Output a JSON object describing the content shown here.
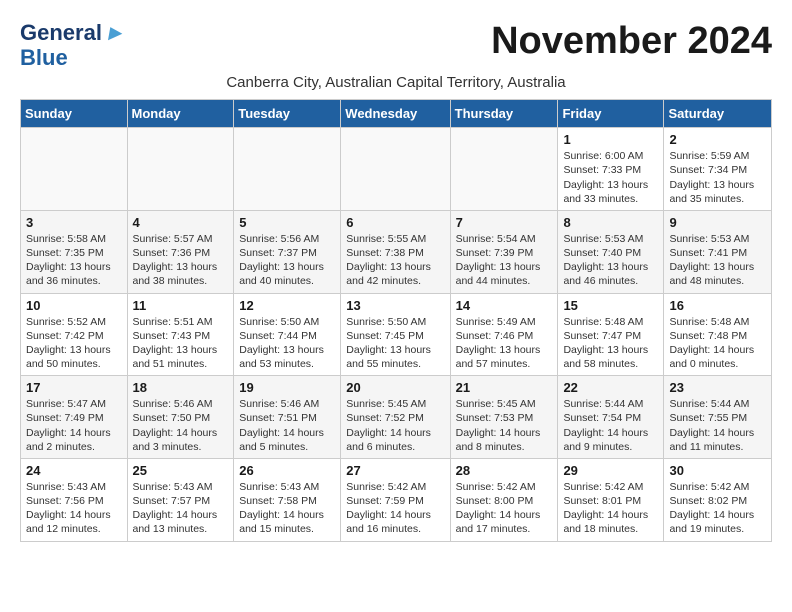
{
  "logo": {
    "line1": "General",
    "line2": "Blue",
    "arrow": "▶"
  },
  "title": "November 2024",
  "subtitle": "Canberra City, Australian Capital Territory, Australia",
  "days_of_week": [
    "Sunday",
    "Monday",
    "Tuesday",
    "Wednesday",
    "Thursday",
    "Friday",
    "Saturday"
  ],
  "weeks": [
    [
      {
        "day": "",
        "info": ""
      },
      {
        "day": "",
        "info": ""
      },
      {
        "day": "",
        "info": ""
      },
      {
        "day": "",
        "info": ""
      },
      {
        "day": "",
        "info": ""
      },
      {
        "day": "1",
        "info": "Sunrise: 6:00 AM\nSunset: 7:33 PM\nDaylight: 13 hours\nand 33 minutes."
      },
      {
        "day": "2",
        "info": "Sunrise: 5:59 AM\nSunset: 7:34 PM\nDaylight: 13 hours\nand 35 minutes."
      }
    ],
    [
      {
        "day": "3",
        "info": "Sunrise: 5:58 AM\nSunset: 7:35 PM\nDaylight: 13 hours\nand 36 minutes."
      },
      {
        "day": "4",
        "info": "Sunrise: 5:57 AM\nSunset: 7:36 PM\nDaylight: 13 hours\nand 38 minutes."
      },
      {
        "day": "5",
        "info": "Sunrise: 5:56 AM\nSunset: 7:37 PM\nDaylight: 13 hours\nand 40 minutes."
      },
      {
        "day": "6",
        "info": "Sunrise: 5:55 AM\nSunset: 7:38 PM\nDaylight: 13 hours\nand 42 minutes."
      },
      {
        "day": "7",
        "info": "Sunrise: 5:54 AM\nSunset: 7:39 PM\nDaylight: 13 hours\nand 44 minutes."
      },
      {
        "day": "8",
        "info": "Sunrise: 5:53 AM\nSunset: 7:40 PM\nDaylight: 13 hours\nand 46 minutes."
      },
      {
        "day": "9",
        "info": "Sunrise: 5:53 AM\nSunset: 7:41 PM\nDaylight: 13 hours\nand 48 minutes."
      }
    ],
    [
      {
        "day": "10",
        "info": "Sunrise: 5:52 AM\nSunset: 7:42 PM\nDaylight: 13 hours\nand 50 minutes."
      },
      {
        "day": "11",
        "info": "Sunrise: 5:51 AM\nSunset: 7:43 PM\nDaylight: 13 hours\nand 51 minutes."
      },
      {
        "day": "12",
        "info": "Sunrise: 5:50 AM\nSunset: 7:44 PM\nDaylight: 13 hours\nand 53 minutes."
      },
      {
        "day": "13",
        "info": "Sunrise: 5:50 AM\nSunset: 7:45 PM\nDaylight: 13 hours\nand 55 minutes."
      },
      {
        "day": "14",
        "info": "Sunrise: 5:49 AM\nSunset: 7:46 PM\nDaylight: 13 hours\nand 57 minutes."
      },
      {
        "day": "15",
        "info": "Sunrise: 5:48 AM\nSunset: 7:47 PM\nDaylight: 13 hours\nand 58 minutes."
      },
      {
        "day": "16",
        "info": "Sunrise: 5:48 AM\nSunset: 7:48 PM\nDaylight: 14 hours\nand 0 minutes."
      }
    ],
    [
      {
        "day": "17",
        "info": "Sunrise: 5:47 AM\nSunset: 7:49 PM\nDaylight: 14 hours\nand 2 minutes."
      },
      {
        "day": "18",
        "info": "Sunrise: 5:46 AM\nSunset: 7:50 PM\nDaylight: 14 hours\nand 3 minutes."
      },
      {
        "day": "19",
        "info": "Sunrise: 5:46 AM\nSunset: 7:51 PM\nDaylight: 14 hours\nand 5 minutes."
      },
      {
        "day": "20",
        "info": "Sunrise: 5:45 AM\nSunset: 7:52 PM\nDaylight: 14 hours\nand 6 minutes."
      },
      {
        "day": "21",
        "info": "Sunrise: 5:45 AM\nSunset: 7:53 PM\nDaylight: 14 hours\nand 8 minutes."
      },
      {
        "day": "22",
        "info": "Sunrise: 5:44 AM\nSunset: 7:54 PM\nDaylight: 14 hours\nand 9 minutes."
      },
      {
        "day": "23",
        "info": "Sunrise: 5:44 AM\nSunset: 7:55 PM\nDaylight: 14 hours\nand 11 minutes."
      }
    ],
    [
      {
        "day": "24",
        "info": "Sunrise: 5:43 AM\nSunset: 7:56 PM\nDaylight: 14 hours\nand 12 minutes."
      },
      {
        "day": "25",
        "info": "Sunrise: 5:43 AM\nSunset: 7:57 PM\nDaylight: 14 hours\nand 13 minutes."
      },
      {
        "day": "26",
        "info": "Sunrise: 5:43 AM\nSunset: 7:58 PM\nDaylight: 14 hours\nand 15 minutes."
      },
      {
        "day": "27",
        "info": "Sunrise: 5:42 AM\nSunset: 7:59 PM\nDaylight: 14 hours\nand 16 minutes."
      },
      {
        "day": "28",
        "info": "Sunrise: 5:42 AM\nSunset: 8:00 PM\nDaylight: 14 hours\nand 17 minutes."
      },
      {
        "day": "29",
        "info": "Sunrise: 5:42 AM\nSunset: 8:01 PM\nDaylight: 14 hours\nand 18 minutes."
      },
      {
        "day": "30",
        "info": "Sunrise: 5:42 AM\nSunset: 8:02 PM\nDaylight: 14 hours\nand 19 minutes."
      }
    ]
  ]
}
